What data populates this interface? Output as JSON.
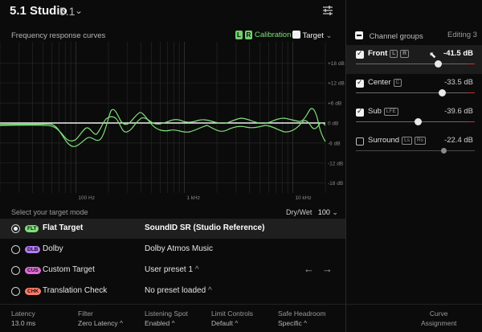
{
  "header": {
    "title": "5.1 Studio",
    "version": "5.1"
  },
  "graph": {
    "title": "Frequency response curves",
    "calibration_badges": [
      "L",
      "R"
    ],
    "calibration_label": "Calibration",
    "target_label": "Target",
    "db_ticks": [
      "+18 dB",
      "+12 dB",
      "+6 dB",
      "0 dB",
      "-6 dB",
      "-12 dB",
      "-18 dB"
    ],
    "freq_ticks": [
      "100 Hz",
      "1 kHz",
      "10 kHz"
    ],
    "curve_color": "#7fe07a",
    "target_color": "#f0f0f0"
  },
  "mode": {
    "prompt": "Select your target mode",
    "drywet_label": "Dry/Wet",
    "drywet_value": "100",
    "rows": [
      {
        "badge": "FLT",
        "badge_color": "#7fe07a",
        "label": "Flat Target",
        "value": "SoundID SR (Studio Reference)",
        "selected": true
      },
      {
        "badge": "DLB",
        "badge_color": "#b57bff",
        "label": "Dolby",
        "value": "Dolby Atmos Music",
        "selected": false
      },
      {
        "badge": "CUS",
        "badge_color": "#e36ad8",
        "label": "Custom Target",
        "value": "User preset 1",
        "selected": false
      },
      {
        "badge": "CHK",
        "badge_color": "#ff7a6b",
        "label": "Translation Check",
        "value": "No preset loaded",
        "selected": false
      }
    ]
  },
  "bottom": {
    "latency_label": "Latency",
    "latency_value": "13.0 ms",
    "filter_label": "Filter",
    "filter_value": "Zero Latency",
    "spot_label": "Listening Spot",
    "spot_value": "Enabled",
    "limit_label": "Limit Controls",
    "limit_value": "Default",
    "headroom_label": "Safe Headroom",
    "headroom_value": "Specific",
    "curve_label": "Curve",
    "assign_label": "Assignment"
  },
  "channels": {
    "header": "Channel groups",
    "editing": "Editing 3",
    "items": [
      {
        "name": "Front",
        "tags": [
          "L",
          "R"
        ],
        "db": "-41.5 dB",
        "checked": true,
        "selected": true,
        "level": 0.69
      },
      {
        "name": "Center",
        "tags": [
          "C"
        ],
        "db": "-33.5 dB",
        "checked": true,
        "selected": false,
        "level": 0.72
      },
      {
        "name": "Sub",
        "tags": [
          "LFE"
        ],
        "db": "-39.6 dB",
        "checked": true,
        "selected": false,
        "level": 0.52
      },
      {
        "name": "Surround",
        "tags": [
          "Ls",
          "Rs"
        ],
        "db": "-22.4 dB",
        "checked": false,
        "selected": false,
        "level": 0.74
      }
    ]
  }
}
